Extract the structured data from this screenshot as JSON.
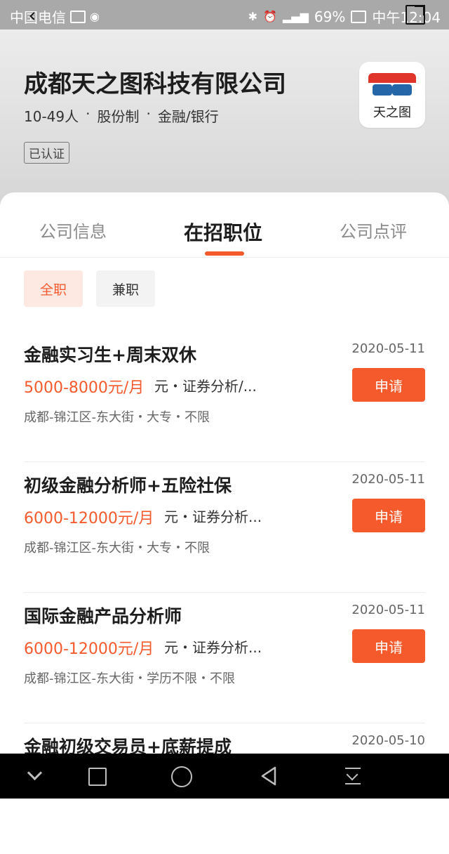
{
  "status_bar": {
    "carrier": "中国电信",
    "battery": "69%",
    "time": "中午12:04"
  },
  "header": {
    "company_name": "成都天之图科技有限公司",
    "size": "10-49人",
    "ownership": "股份制",
    "industry": "金融/银行",
    "verified": "已认证",
    "logo_text": "天之图"
  },
  "tabs": [
    {
      "label": "公司信息"
    },
    {
      "label": "在招职位"
    },
    {
      "label": "公司点评"
    }
  ],
  "filters": [
    {
      "label": "全职"
    },
    {
      "label": "兼职"
    }
  ],
  "jobs": [
    {
      "title": "金融实习生+周末双休",
      "date": "2020-05-11",
      "salary": "5000-8000元/月",
      "category": "元・证券分析/...",
      "location": "成都-锦江区-东大街・大专・不限",
      "apply": "申请"
    },
    {
      "title": "初级金融分析师+五险社保",
      "date": "2020-05-11",
      "salary": "6000-12000元/月",
      "category": "元・证券分析...",
      "location": "成都-锦江区-东大街・大专・不限",
      "apply": "申请"
    },
    {
      "title": "国际金融产品分析师",
      "date": "2020-05-11",
      "salary": "6000-12000元/月",
      "category": "元・证券分析...",
      "location": "成都-锦江区-东大街・学历不限・不限",
      "apply": "申请"
    },
    {
      "title": "金融初级交易员+底薪提成",
      "date": "2020-05-10",
      "salary": "",
      "category": "",
      "location": "",
      "apply": ""
    }
  ],
  "icons": {
    "back": "chevron-left-icon",
    "share": "share-icon",
    "nav": [
      "chevron-down-icon",
      "square-icon",
      "circle-icon",
      "triangle-back-icon",
      "notification-icon"
    ]
  },
  "colors": {
    "accent": "#f55a2c",
    "header_bg": "#dcdcdc"
  }
}
